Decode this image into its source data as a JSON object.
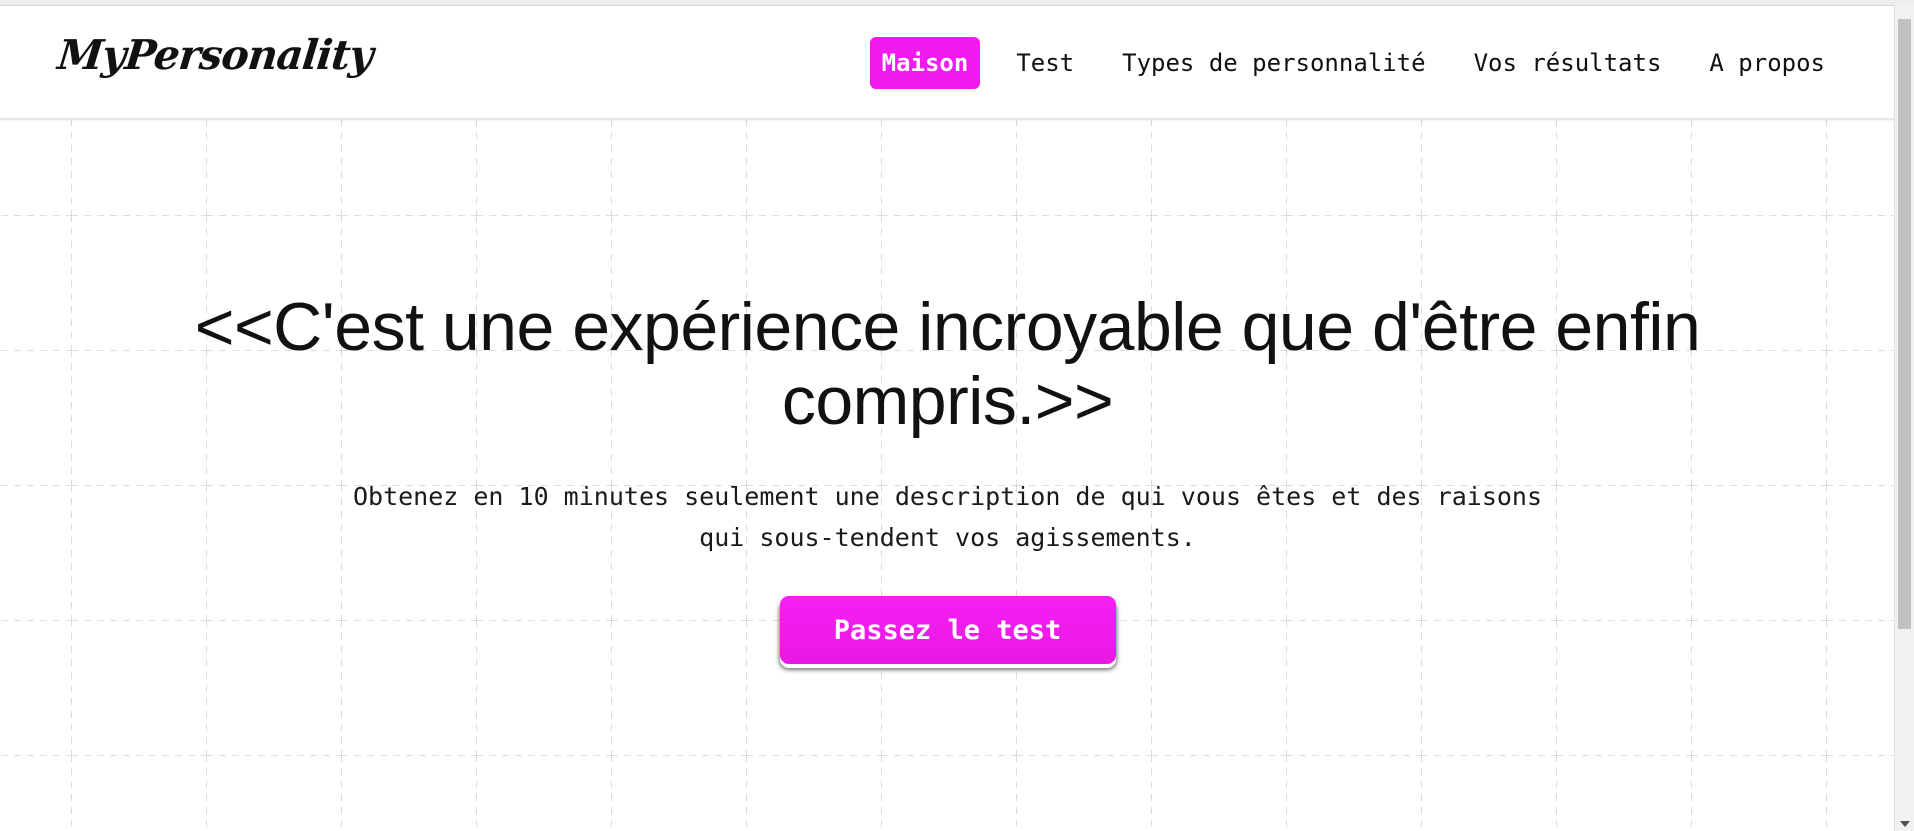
{
  "header": {
    "logo_text": "MyPersonality",
    "nav": [
      {
        "label": "Maison",
        "active": true
      },
      {
        "label": "Test",
        "active": false
      },
      {
        "label": "Types de personnalité",
        "active": false
      },
      {
        "label": "Vos résultats",
        "active": false
      },
      {
        "label": "A propos",
        "active": false
      }
    ]
  },
  "hero": {
    "title": "<<C'est une expérience incroyable que d'être enfin compris.>>",
    "subtitle_line1": "Obtenez en 10 minutes seulement une description de qui vous êtes et des raisons",
    "subtitle_line2": "qui sous-tendent vos agissements.",
    "cta_label": "Passez le test"
  },
  "colors": {
    "accent": "#f01aef",
    "grid_line": "#c9c9c9",
    "text": "#111111"
  }
}
